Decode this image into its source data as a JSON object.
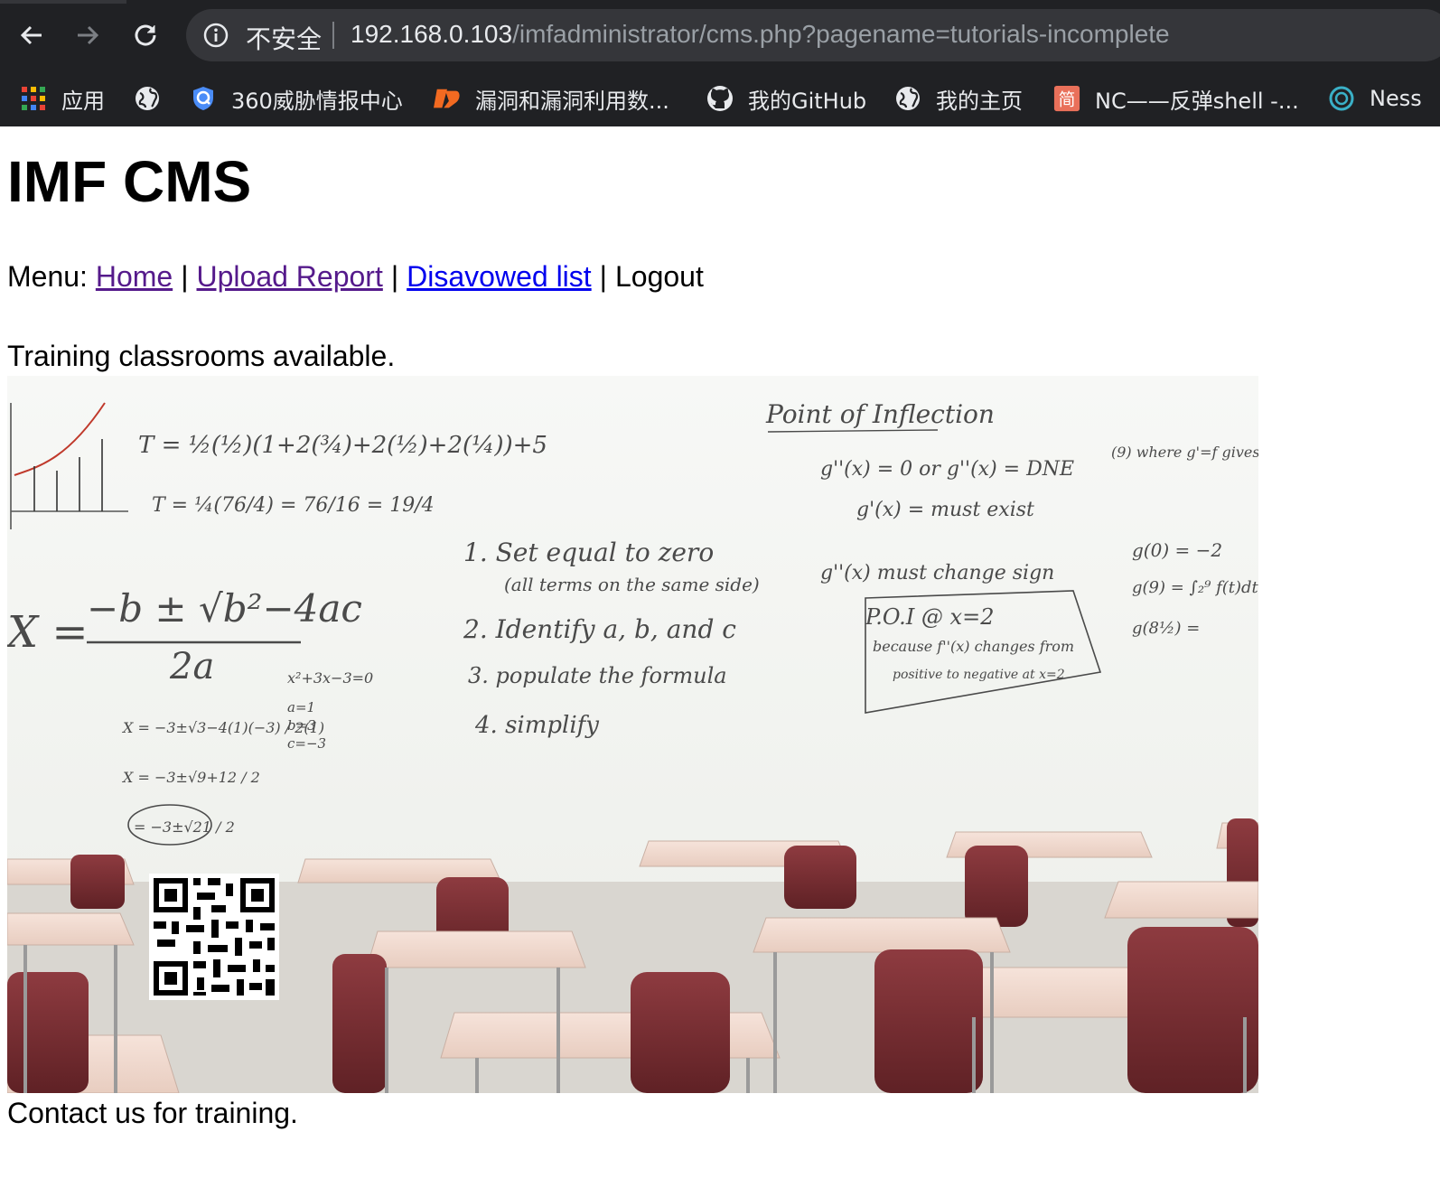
{
  "browser": {
    "security_label": "不安全",
    "url_host": "192.168.0.103",
    "url_path": "/imfadministrator/cms.php?pagename=tutorials-incomplete"
  },
  "bookmarks": [
    {
      "label": "应用",
      "icon": "apps-grid-icon"
    },
    {
      "label": "",
      "icon": "globe-icon"
    },
    {
      "label": "360威胁情报中心",
      "icon": "360-shield-icon"
    },
    {
      "label": "漏洞和漏洞利用数...",
      "icon": "exploit-db-icon"
    },
    {
      "label": "我的GitHub",
      "icon": "github-icon"
    },
    {
      "label": "我的主页",
      "icon": "globe-icon"
    },
    {
      "label": "NC——反弹shell -...",
      "icon": "jianshu-icon"
    },
    {
      "label": "Ness",
      "icon": "nessus-icon"
    }
  ],
  "page": {
    "title": "IMF CMS",
    "menu_prefix": "Menu:",
    "menu": [
      {
        "label": "Home",
        "link": true
      },
      {
        "label": "Upload Report",
        "link": true
      },
      {
        "label": "Disavowed list",
        "link": true
      },
      {
        "label": "Logout",
        "link": false
      }
    ],
    "intro_text": "Training classrooms available.",
    "contact_text": "Contact us for training."
  },
  "whiteboard": {
    "heading": "Point of Inflection",
    "steps": [
      "1. Set equal to zero",
      "(all terms on the same side)",
      "2. Identify a, b, and c",
      "3. populate the formula",
      "4. simplify"
    ],
    "formula_top": "−b ± √b²−4ac",
    "formula_bottom": "2a",
    "formula_x": "X =",
    "inflection_lines": [
      "g''(x) = 0  or  g''(x) = DNE",
      "g'(x) = must exist",
      "g''(x) must change sign",
      "P.O.I @ x=2",
      "because f''(x) changes from",
      "positive to negative at x=2"
    ],
    "trap_lines": [
      "T = ½(½)(1+2(¾)+2(½)+2(¼))+5",
      "T = ¼(76/4) = 76/16 = 19/4"
    ],
    "quad_lines": [
      "x²+3x−3=0",
      "a=1",
      "b=3",
      "c=−3"
    ],
    "solve_lines": [
      "X = −3±√3−4(1)(−3) / 2(1)",
      "X = −3±√9+12 / 2",
      "= −3±√21 / 2"
    ],
    "right_lines": [
      "(9) where g'=f gives",
      "g(0) = −2",
      "g(9) = ∫₂⁹ f(t)dt",
      "g(8½) ="
    ]
  }
}
